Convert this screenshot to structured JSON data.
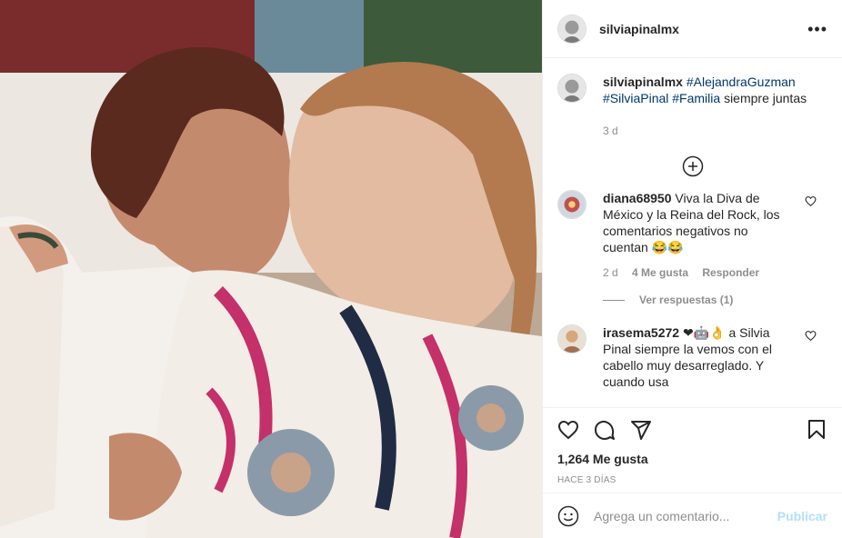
{
  "post": {
    "username": "silviapinalmx",
    "caption_hashtags": [
      "#AlejandraGuzman",
      "#SilviaPinal",
      "#Familia"
    ],
    "caption_text": "siempre juntas",
    "caption_time": "3 d",
    "likes": "1,264 Me gusta",
    "posted_ago": "HACE 3 DÍAS"
  },
  "comments": [
    {
      "username": "diana68950",
      "text": "Viva la Diva de México y la Reina del Rock, los comentarios negativos no cuentan 😂😂",
      "time": "2 d",
      "likes": "4 Me gusta",
      "reply": "Responder",
      "view_replies": "Ver respuestas (1)"
    },
    {
      "username": "irasema5272",
      "text": "❤🤖👌 a Silvia Pinal siempre la vemos con el cabello muy desarreglado. Y cuando usa"
    }
  ],
  "add_comment": {
    "placeholder": "Agrega un comentario...",
    "post_label": "Publicar"
  },
  "icons": {
    "more": "more-options-icon",
    "new_comments": "plus-circle-icon",
    "like": "heart-icon",
    "comment": "comment-icon",
    "share": "share-icon",
    "save": "bookmark-icon",
    "emoji": "emoji-icon"
  }
}
